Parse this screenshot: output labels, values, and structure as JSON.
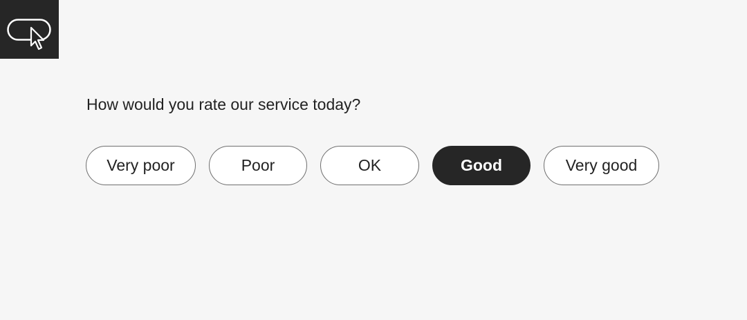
{
  "app": {
    "logo_icon": "button-cursor-icon",
    "colors": {
      "background": "#f6f6f6",
      "dark": "#262626",
      "border": "#6e6e6e",
      "text": "#222222"
    }
  },
  "rating": {
    "question": "How would you rate our service today?",
    "selected_index": 3,
    "options": [
      {
        "label": "Very poor"
      },
      {
        "label": "Poor"
      },
      {
        "label": "OK"
      },
      {
        "label": "Good"
      },
      {
        "label": "Very good"
      }
    ]
  }
}
